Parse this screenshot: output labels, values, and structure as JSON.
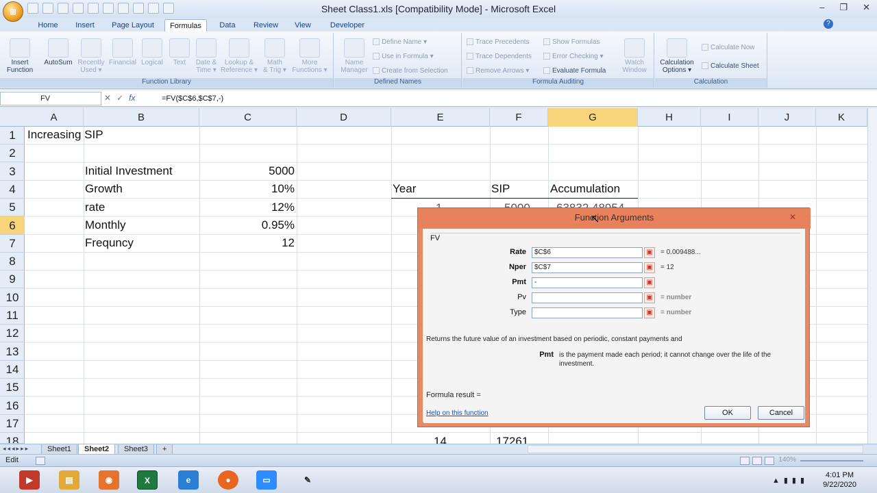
{
  "window": {
    "title": "Sheet Class1.xls  [Compatibility Mode] - Microsoft Excel",
    "controls": [
      "–",
      "❐",
      "✕"
    ]
  },
  "office_button_label": "⊞",
  "ribbon_tabs": [
    "Home",
    "Insert",
    "Page Layout",
    "Formulas",
    "Data",
    "Review",
    "View",
    "Developer"
  ],
  "active_tab": "Formulas",
  "ribbon": {
    "function_library": {
      "label": "Function Library",
      "buttons": [
        "Insert\nFunction",
        "AutoSum",
        "Recently\nUsed ▾",
        "Financial",
        "Logical",
        "Text",
        "Date &\nTime ▾",
        "Lookup &\nReference ▾",
        "Math\n& Trig ▾",
        "More\nFunctions ▾"
      ]
    },
    "defined_names": {
      "label": "Defined Names",
      "name_manager": "Name\nManager",
      "items": [
        "Define Name ▾",
        "Use in Formula ▾",
        "Create from Selection"
      ]
    },
    "formula_auditing": {
      "label": "Formula Auditing",
      "items": [
        "Trace Precedents",
        "Trace Dependents",
        "Remove Arrows ▾",
        "Show Formulas",
        "Error Checking ▾",
        "Evaluate Formula"
      ],
      "watch_window": "Watch\nWindow"
    },
    "calculation": {
      "label": "Calculation",
      "options": "Calculation\nOptions ▾",
      "items": [
        "Calculate Now",
        "Calculate Sheet"
      ]
    }
  },
  "formula_bar": {
    "name_box": "FV",
    "tools": [
      "✕",
      "✓",
      "fx"
    ],
    "formula": "=FV($C$6,$C$7,-)"
  },
  "columns": [
    "A",
    "B",
    "C",
    "D",
    "E",
    "F",
    "G",
    "H",
    "I",
    "J",
    "K"
  ],
  "selected_column": "G",
  "rows": [
    "1",
    "2",
    "3",
    "4",
    "5",
    "6",
    "7",
    "8",
    "9",
    "10",
    "11",
    "12",
    "13",
    "14",
    "15",
    "16",
    "17",
    "18"
  ],
  "selected_row": "6",
  "cells": {
    "a1": "Increasing SIP",
    "b3": "Initial Investment",
    "c3": "5000",
    "b4": "Growth",
    "c4": "10%",
    "b5": "rate",
    "c5": "12%",
    "b6": "Monthly",
    "c6": "0.95%",
    "b7": "Frequncy",
    "c7": "12",
    "e4": "Year",
    "f4": "SIP",
    "g4": "Accumulation",
    "e5": "1",
    "f5": "5000",
    "g5": "63832.48954",
    "e18": "14",
    "f18": "17261"
  },
  "dialog": {
    "title": "Function Arguments",
    "function_name": "FV",
    "args": [
      {
        "label": "Rate",
        "value": "$C$6",
        "result": "= 0.009488..."
      },
      {
        "label": "Nper",
        "value": "$C$7",
        "result": "= 12"
      },
      {
        "label": "Pmt",
        "value": "-",
        "result": ""
      },
      {
        "label": "Pv",
        "value": "",
        "result": "= number"
      },
      {
        "label": "Type",
        "value": "",
        "result": "= number"
      }
    ],
    "description": "Returns the future value of an investment based on periodic, constant payments and",
    "pmt_label": "Pmt",
    "pmt_help": "is the payment made each period; it cannot change over the life of the investment.",
    "formula_result_label": "Formula result =",
    "help_link": "Help on this function",
    "ok": "OK",
    "cancel": "Cancel"
  },
  "sheet_tabs": [
    "Sheet1",
    "Sheet2",
    "Sheet3"
  ],
  "active_sheet": "Sheet2",
  "status": {
    "mode": "Edit",
    "zoom": "140%"
  },
  "taskbar": {
    "apps": [
      "presentation-app",
      "file-explorer",
      "media-app",
      "excel",
      "internet-explorer",
      "firefox",
      "zoom",
      "pen-tool"
    ],
    "time": "4:01 PM",
    "date": "9/22/2020"
  }
}
